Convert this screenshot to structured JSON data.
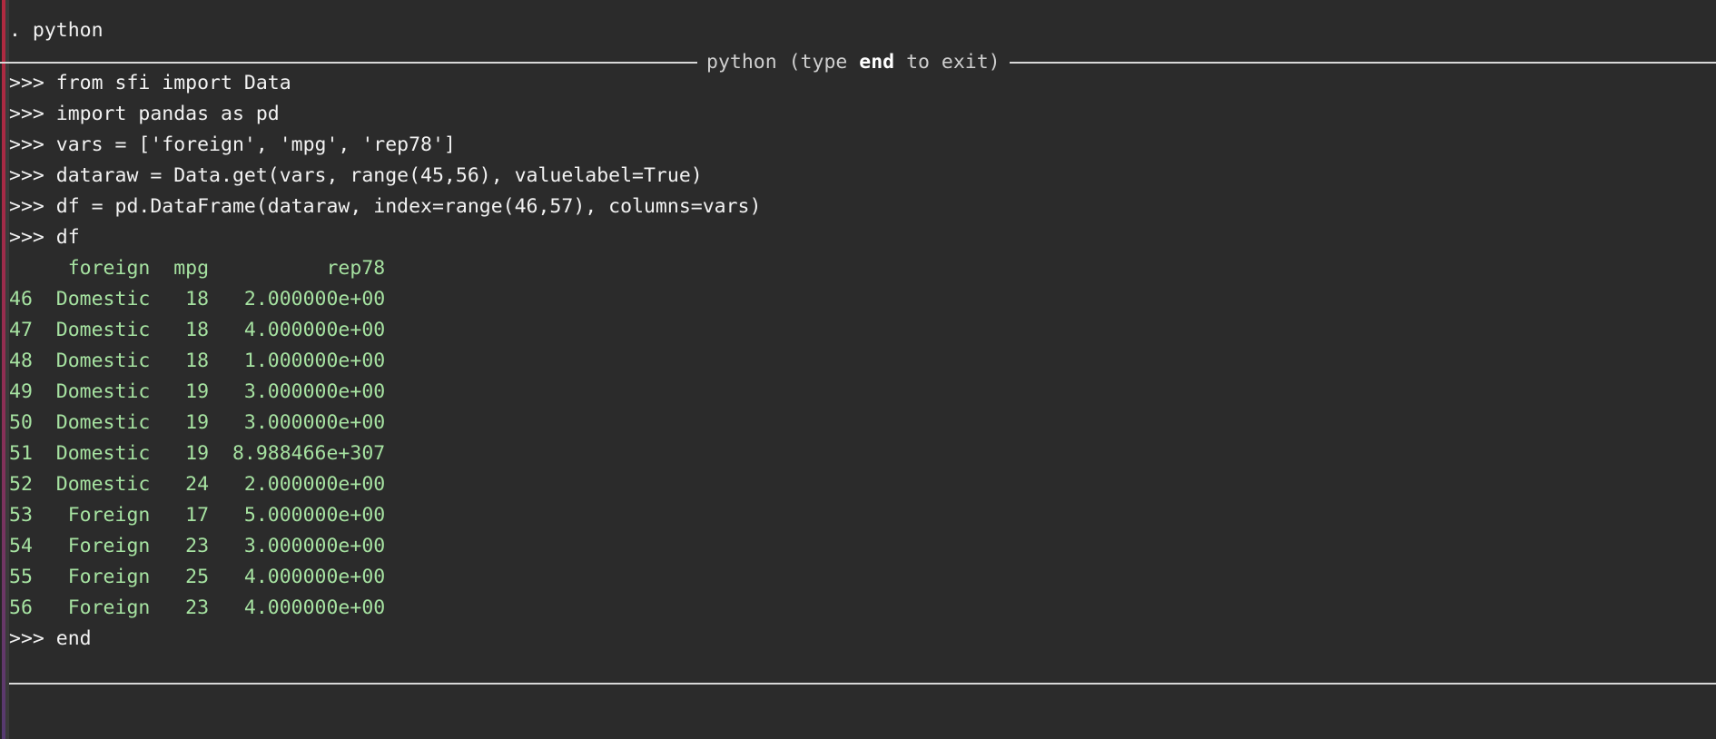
{
  "terminal": {
    "app": "Stata",
    "background_color": "#2b2b2b",
    "prompt_text_color": "#f2f2f2",
    "output_text_color": "#a6e2a1",
    "accent_gradient_top": "#b02a3f",
    "accent_gradient_bottom": "#553a70"
  },
  "stata_command": ". python",
  "header": {
    "label_prefix": "python (type ",
    "label_keyword": "end",
    "label_suffix": " to exit)"
  },
  "session": {
    "prompt": ">>>",
    "commands": [
      ">>> from sfi import Data",
      ">>> import pandas as pd",
      ">>> vars = ['foreign', 'mpg', 'rep78']",
      ">>> dataraw = Data.get(vars, range(45,56), valuelabel=True)",
      ">>> df = pd.DataFrame(dataraw, index=range(46,57), columns=vars)",
      ">>> df"
    ],
    "end_command": ">>> end"
  },
  "dataframe": {
    "header_line": "     foreign  mpg          rep78",
    "columns": [
      "foreign",
      "mpg",
      "rep78"
    ],
    "index_name": "",
    "rows": [
      {
        "index": "46",
        "line": "46  Domestic   18   2.000000e+00",
        "foreign": "Domestic",
        "mpg": "18",
        "rep78": "2.000000e+00"
      },
      {
        "index": "47",
        "line": "47  Domestic   18   4.000000e+00",
        "foreign": "Domestic",
        "mpg": "18",
        "rep78": "4.000000e+00"
      },
      {
        "index": "48",
        "line": "48  Domestic   18   1.000000e+00",
        "foreign": "Domestic",
        "mpg": "18",
        "rep78": "1.000000e+00"
      },
      {
        "index": "49",
        "line": "49  Domestic   19   3.000000e+00",
        "foreign": "Domestic",
        "mpg": "19",
        "rep78": "3.000000e+00"
      },
      {
        "index": "50",
        "line": "50  Domestic   19   3.000000e+00",
        "foreign": "Domestic",
        "mpg": "19",
        "rep78": "3.000000e+00"
      },
      {
        "index": "51",
        "line": "51  Domestic   19  8.988466e+307",
        "foreign": "Domestic",
        "mpg": "19",
        "rep78": "8.988466e+307"
      },
      {
        "index": "52",
        "line": "52  Domestic   24   2.000000e+00",
        "foreign": "Domestic",
        "mpg": "24",
        "rep78": "2.000000e+00"
      },
      {
        "index": "53",
        "line": "53   Foreign   17   5.000000e+00",
        "foreign": "Foreign",
        "mpg": "17",
        "rep78": "5.000000e+00"
      },
      {
        "index": "54",
        "line": "54   Foreign   23   3.000000e+00",
        "foreign": "Foreign",
        "mpg": "23",
        "rep78": "3.000000e+00"
      },
      {
        "index": "55",
        "line": "55   Foreign   25   4.000000e+00",
        "foreign": "Foreign",
        "mpg": "25",
        "rep78": "4.000000e+00"
      },
      {
        "index": "56",
        "line": "56   Foreign   23   4.000000e+00",
        "foreign": "Foreign",
        "mpg": "23",
        "rep78": "4.000000e+00"
      }
    ]
  }
}
